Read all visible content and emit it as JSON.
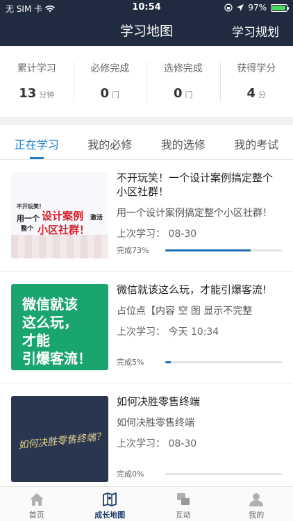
{
  "status": {
    "carrier": "无 SIM 卡",
    "time": "10:54",
    "battery": "97%"
  },
  "header": {
    "title": "学习地图",
    "right_action": "学习规划"
  },
  "stats": [
    {
      "label": "累计学习",
      "value": "13",
      "unit": "分钟"
    },
    {
      "label": "必修完成",
      "value": "0",
      "unit": "门"
    },
    {
      "label": "选修完成",
      "value": "0",
      "unit": "门"
    },
    {
      "label": "获得学分",
      "value": "4",
      "unit": "分"
    }
  ],
  "tabs": [
    {
      "label": "正在学习",
      "active": true
    },
    {
      "label": "我的必修"
    },
    {
      "label": "我的选修"
    },
    {
      "label": "我的考试"
    }
  ],
  "courses": [
    {
      "title": "不开玩笑！一个设计案例搞定整个小区社群！",
      "desc": "用一个设计案例搞定整个小区社群！",
      "last": "上次学习：  08-30",
      "progress_text": "完成73%",
      "progress": 0.73,
      "thumb": {
        "line1": "不开玩笑！",
        "line2": "用一个",
        "line3": "设计案例",
        "line4": "激活",
        "line5": "整个",
        "line6": "小区社群！"
      }
    },
    {
      "title": "微信就该这么玩，才能引爆客流!",
      "desc": "占位点【内容 空 图 显示不完整",
      "last": "上次学习：  今天 10:34",
      "progress_text": "完成5%",
      "progress": 0.05,
      "thumb": {
        "lines": [
          "微信就该",
          "这么玩，",
          "才能",
          "引爆客流！"
        ]
      }
    },
    {
      "title": "如何决胜零售终端",
      "desc": "如何决胜零售终端",
      "last": "上次学习：  08-30",
      "progress_text": "完成0%",
      "progress": 0,
      "thumb": {
        "text": "如何决胜零售终端？"
      }
    }
  ],
  "nav": [
    {
      "label": "首页",
      "icon": "home-icon"
    },
    {
      "label": "成长地图",
      "icon": "map-icon",
      "active": true
    },
    {
      "label": "互动",
      "icon": "interact-icon"
    },
    {
      "label": "我的",
      "icon": "profile-icon"
    }
  ],
  "colors": {
    "header": "#212b3f",
    "accent": "#1f7dc7",
    "progress": "#1f6fb8"
  }
}
